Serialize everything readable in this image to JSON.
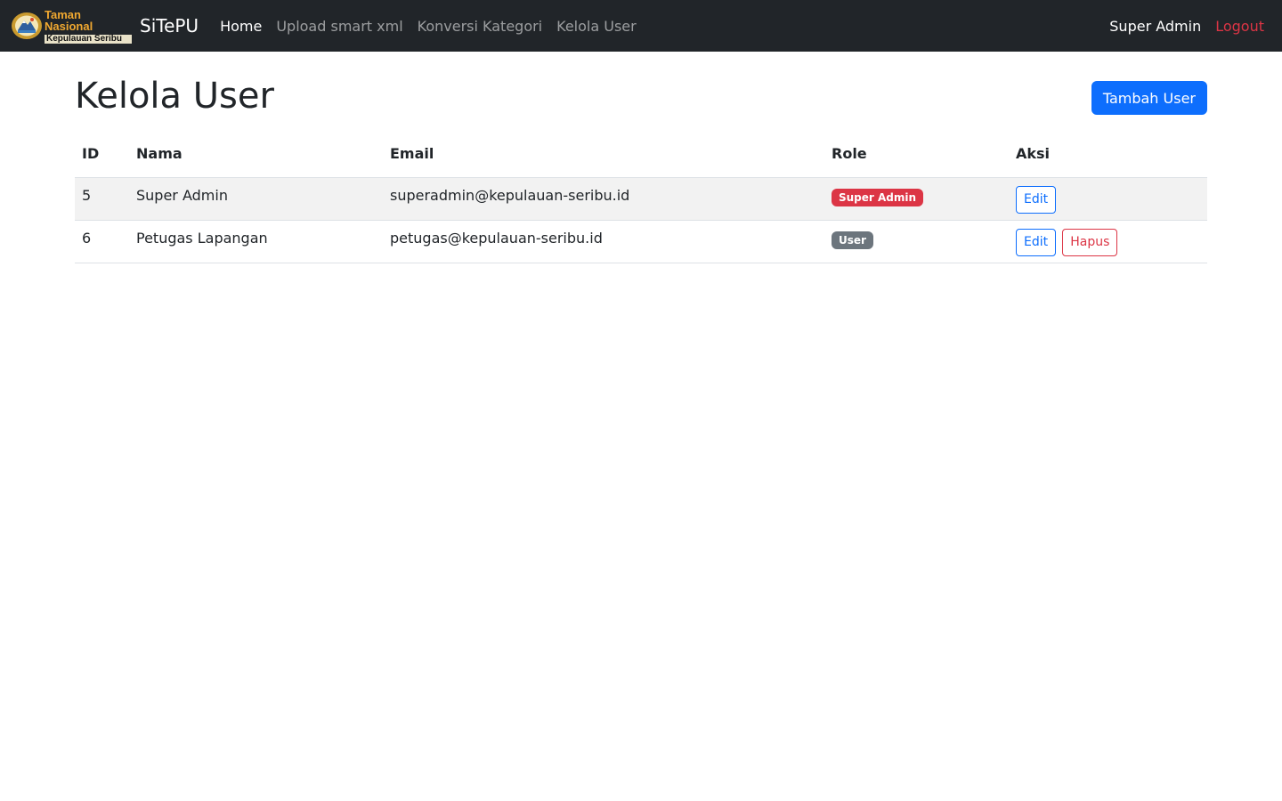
{
  "navbar": {
    "logo": {
      "line1": "Taman Nasional",
      "line2": "Kepulauan Seribu"
    },
    "site_name": "SiTePU",
    "links": [
      {
        "label": "Home",
        "active": true
      },
      {
        "label": "Upload smart xml",
        "active": false
      },
      {
        "label": "Konversi Kategori",
        "active": false
      },
      {
        "label": "Kelola User",
        "active": false
      }
    ],
    "user_name": "Super Admin",
    "logout_label": "Logout"
  },
  "main": {
    "title": "Kelola User",
    "add_button_label": "Tambah User",
    "table": {
      "headers": [
        "ID",
        "Nama",
        "Email",
        "Role",
        "Aksi"
      ],
      "rows": [
        {
          "id": "5",
          "nama": "Super Admin",
          "email": "superadmin@kepulauan-seribu.id",
          "role": "Super Admin",
          "role_color": "#dc3545",
          "actions": [
            "Edit"
          ]
        },
        {
          "id": "6",
          "nama": "Petugas Lapangan",
          "email": "petugas@kepulauan-seribu.id",
          "role": "User",
          "role_color": "#6c757d",
          "actions": [
            "Edit",
            "Hapus"
          ]
        }
      ]
    }
  },
  "colors": {
    "navbar_bg": "#212529",
    "primary": "#0d6efd",
    "danger": "#dc3545",
    "secondary": "#6c757d"
  },
  "icons": {
    "logo": "taman-nasional-emblem-icon"
  }
}
